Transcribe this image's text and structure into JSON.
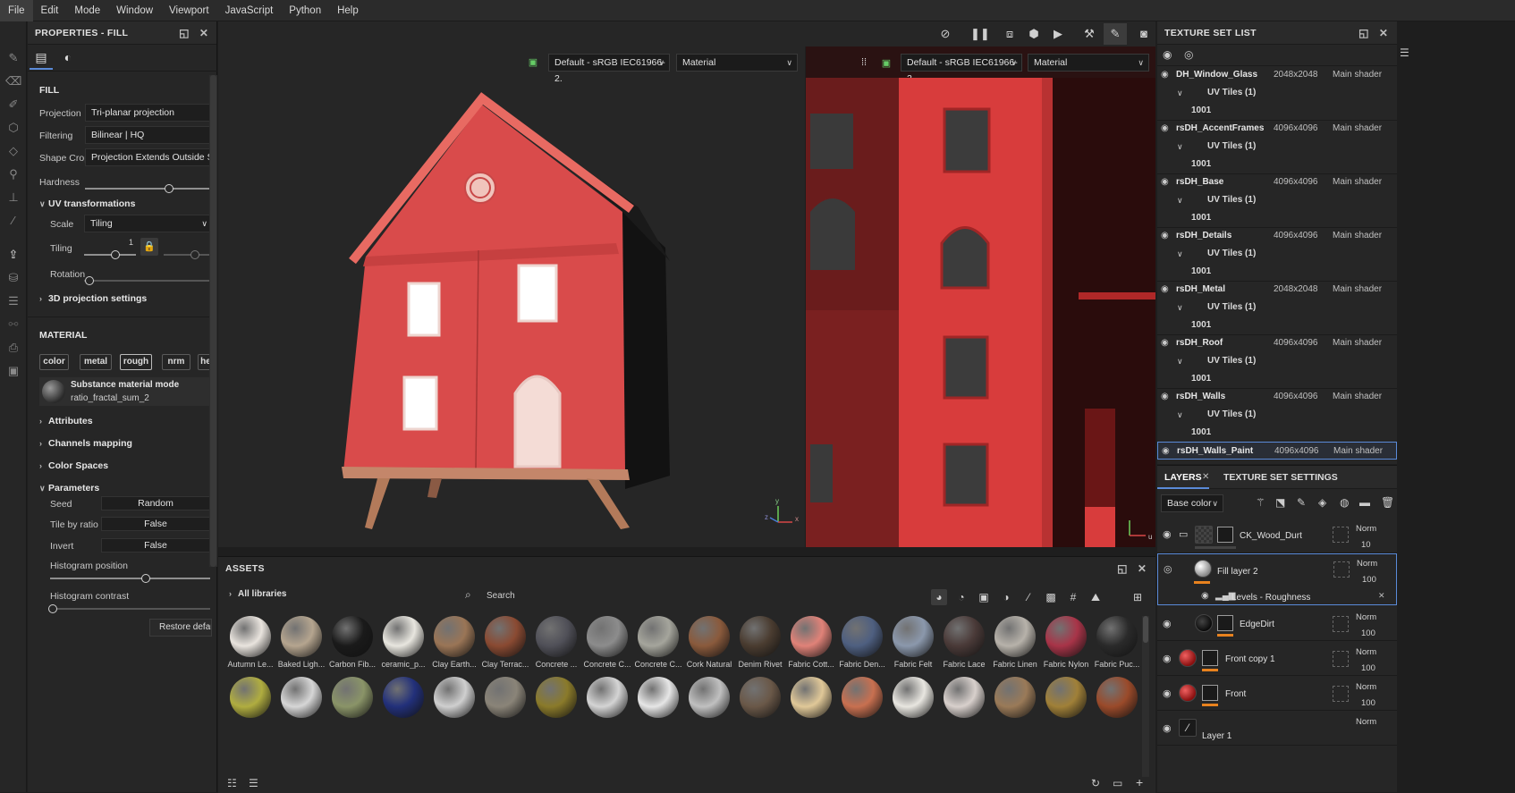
{
  "menu": [
    "File",
    "Edit",
    "Mode",
    "Window",
    "Viewport",
    "JavaScript",
    "Python",
    "Help"
  ],
  "properties": {
    "title": "PROPERTIES - FILL",
    "fill_label": "FILL",
    "projection_label": "Projection",
    "projection_value": "Tri-planar projection",
    "filtering_label": "Filtering",
    "filtering_value": "Bilinear | HQ",
    "shape_crop_label": "Shape Crop",
    "shape_crop_value": "Projection Extends Outside Shap",
    "hardness_label": "Hardness",
    "hardness_value": 0.67,
    "uv_label": "UV transformations",
    "scale_label": "Scale",
    "scale_value": "Tiling",
    "tiling_label": "Tiling",
    "tiling_value": "1",
    "rotation_label": "Rotation",
    "projection3d_label": "3D projection settings",
    "material_label": "MATERIAL",
    "channels": [
      "color",
      "metal",
      "rough",
      "nrm",
      "he"
    ],
    "selected_channel": "rough",
    "material_mode": "Substance material mode",
    "material_name": "ratio_fractal_sum_2",
    "attributes_label": "Attributes",
    "channels_mapping_label": "Channels mapping",
    "color_spaces_label": "Color Spaces",
    "parameters_label": "Parameters",
    "seed_label": "Seed",
    "seed_value": "Random",
    "tile_ratio_label": "Tile by ratio",
    "tile_ratio_value": "False",
    "invert_label": "Invert",
    "invert_value": "False",
    "hist_pos_label": "Histogram position",
    "hist_pos_value": 0.6,
    "hist_contrast_label": "Histogram contrast",
    "hist_contrast_value": 0.0,
    "restore_label": "Restore defau"
  },
  "viewport": {
    "colorspace_3d": "Default - sRGB IEC61966-2.",
    "mode_3d": "Material",
    "colorspace_2d": "Default - sRGB IEC61966-2.",
    "mode_2d": "Material",
    "axis_y": "y",
    "axis_x": "x",
    "axis_z": "z",
    "axis_u": "u"
  },
  "texture_set_list": {
    "title": "TEXTURE SET LIST",
    "sets": [
      {
        "name": "DH_Window_Glass",
        "res": "2048x2048",
        "shader": "Main shader",
        "uv": "UV Tiles (1)",
        "tile": "1001"
      },
      {
        "name": "rsDH_AccentFrames",
        "res": "4096x4096",
        "shader": "Main shader",
        "uv": "UV Tiles (1)",
        "tile": "1001"
      },
      {
        "name": "rsDH_Base",
        "res": "4096x4096",
        "shader": "Main shader",
        "uv": "UV Tiles (1)",
        "tile": "1001"
      },
      {
        "name": "rsDH_Details",
        "res": "4096x4096",
        "shader": "Main shader",
        "uv": "UV Tiles (1)",
        "tile": "1001"
      },
      {
        "name": "rsDH_Metal",
        "res": "2048x2048",
        "shader": "Main shader",
        "uv": "UV Tiles (1)",
        "tile": "1001"
      },
      {
        "name": "rsDH_Roof",
        "res": "4096x4096",
        "shader": "Main shader",
        "uv": "UV Tiles (1)",
        "tile": "1001"
      },
      {
        "name": "rsDH_Walls",
        "res": "4096x4096",
        "shader": "Main shader",
        "uv": "UV Tiles (1)",
        "tile": "1001"
      },
      {
        "name": "rsDH_Walls_Paint",
        "res": "4096x4096",
        "shader": "Main shader"
      }
    ]
  },
  "layers_panel": {
    "tab_layers": "LAYERS",
    "tab_tss": "TEXTURE SET SETTINGS",
    "channel": "Base color",
    "layers": [
      {
        "name": "CK_Wood_Durt",
        "blend": "Norm",
        "opacity": "10"
      },
      {
        "name": "Fill layer 2",
        "blend": "Norm",
        "opacity": "100",
        "effect": "Levels - Roughness"
      },
      {
        "name": "EdgeDirt",
        "blend": "Norm",
        "opacity": "100"
      },
      {
        "name": "Front copy 1",
        "blend": "Norm",
        "opacity": "100"
      },
      {
        "name": "Front",
        "blend": "Norm",
        "opacity": "100"
      },
      {
        "name": "Layer 1",
        "blend": "Norm"
      }
    ]
  },
  "assets": {
    "title": "ASSETS",
    "library": "All libraries",
    "search_placeholder": "Search",
    "row1": [
      {
        "label": "Autumn Le...",
        "color": "#e9e4de"
      },
      {
        "label": "Baked Ligh...",
        "color": "#b5a58f"
      },
      {
        "label": "Carbon Fib...",
        "color": "#1a1a1a"
      },
      {
        "label": "ceramic_p...",
        "color": "#e8e6df"
      },
      {
        "label": "Clay Earth...",
        "color": "#9a7556"
      },
      {
        "label": "Clay Terrac...",
        "color": "#8a4a32"
      },
      {
        "label": "Concrete ...",
        "color": "#505058"
      },
      {
        "label": "Concrete C...",
        "color": "#8c8c8c"
      },
      {
        "label": "Concrete C...",
        "color": "#a5a59c"
      },
      {
        "label": "Cork Natural",
        "color": "#8a5a3c"
      },
      {
        "label": "Denim Rivet",
        "color": "#4a3c30"
      },
      {
        "label": "Fabric Cott...",
        "color": "#e08278"
      },
      {
        "label": "Fabric Den...",
        "color": "#4e5f80"
      },
      {
        "label": "Fabric Felt",
        "color": "#8b98ac"
      },
      {
        "label": "Fabric Lace",
        "color": "#4a3a38"
      },
      {
        "label": "Fabric Linen",
        "color": "#b7b2aa"
      },
      {
        "label": "Fabric Nylon",
        "color": "#a83448"
      },
      {
        "label": "Fabric Puc...",
        "color": "#2a2a2a"
      }
    ],
    "row2_colors": [
      "#b0ad40",
      "#d6d6d6",
      "#8a9468",
      "#22307a",
      "#cfcfcf",
      "#8a8478",
      "#8a7a2a",
      "#d4d4d4",
      "#e6e6e6",
      "#c0c0c0",
      "#6a5848",
      "#e0c898",
      "#c87050",
      "#e8e6e0",
      "#d8d0cc",
      "#9a7a58",
      "#a08038",
      "#9a4a2a"
    ]
  },
  "colors": {
    "accent_orange": "#e8821e",
    "selection_blue": "#5a8ad8",
    "house_red": "#e05454"
  }
}
